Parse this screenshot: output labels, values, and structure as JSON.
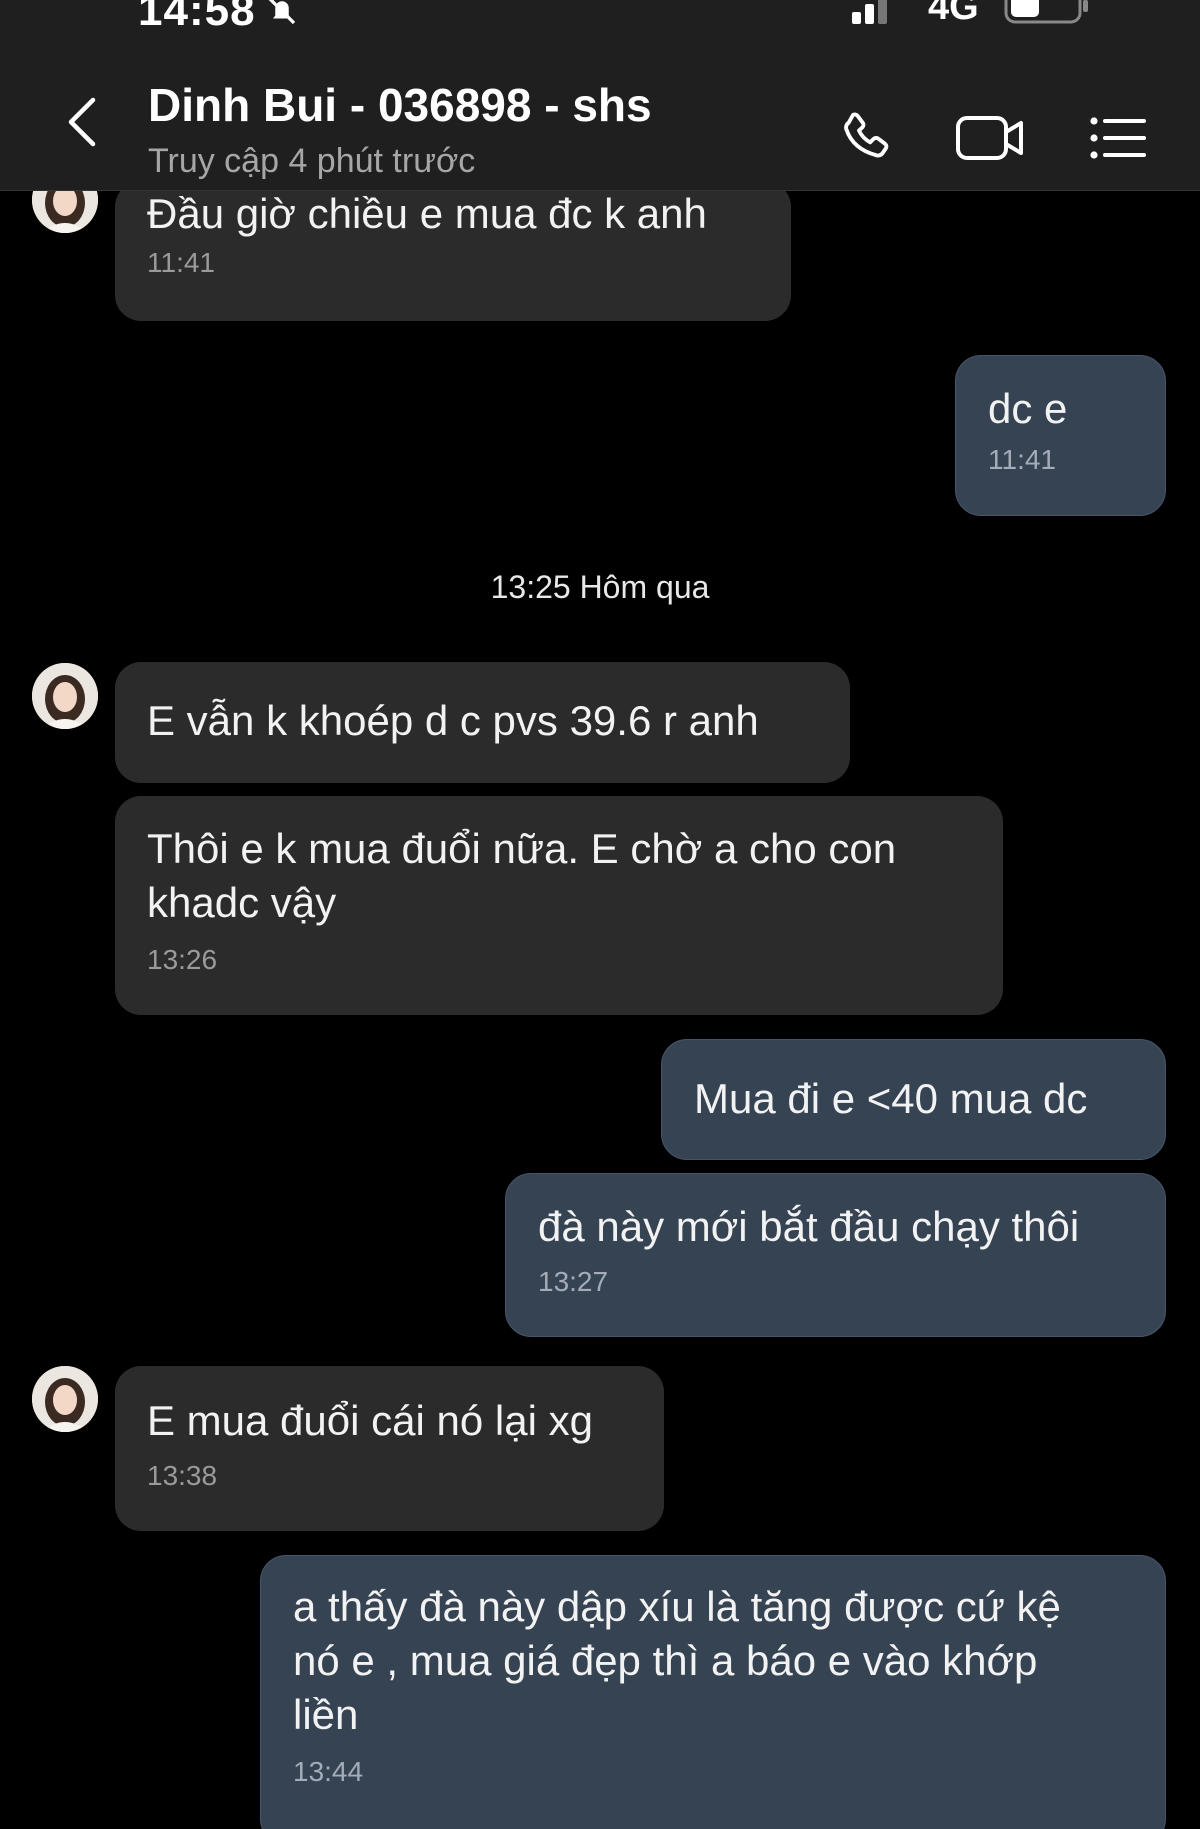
{
  "status_bar": {
    "time": "14:58",
    "network": "4G"
  },
  "header": {
    "contact_name": "Dinh Bui - 036898 - shs",
    "last_seen": "Truy cập 4 phút trước"
  },
  "messages": [
    {
      "direction": "in",
      "text": "Đầu giờ chiều e mua đc k anh",
      "time": "11:41"
    },
    {
      "direction": "out",
      "text": "dc e",
      "time": "11:41"
    },
    {
      "direction": "separator",
      "text": "13:25 Hôm qua"
    },
    {
      "direction": "in",
      "text": "E vẫn k khoép d c pvs 39.6 r anh"
    },
    {
      "direction": "in",
      "text_lines": [
        "Thôi e k mua đuổi nữa. E chờ a cho con",
        "khadc vậy"
      ],
      "time": "13:26"
    },
    {
      "direction": "out",
      "text": "Mua đi e <40 mua dc"
    },
    {
      "direction": "out",
      "text": "đà này mới bắt đầu chạy thôi",
      "time": "13:27"
    },
    {
      "direction": "in",
      "text": "E mua đuổi cái nó lại xg",
      "time": "13:38"
    },
    {
      "direction": "out",
      "text_lines": [
        "a thấy đà này dập xíu là tăng được cứ kệ",
        "nó e , mua giá đẹp thì a báo e vào khớp",
        "liền"
      ],
      "time": "13:44"
    }
  ],
  "colors": {
    "background": "#000000",
    "header": "#1f1f1f",
    "incoming_bubble": "#2b2b2b",
    "outgoing_bubble": "#364353"
  },
  "icons": {
    "back": "chevron-left-icon",
    "call": "phone-icon",
    "video": "video-camera-icon",
    "menu": "list-icon",
    "mute": "bell-off-icon"
  }
}
